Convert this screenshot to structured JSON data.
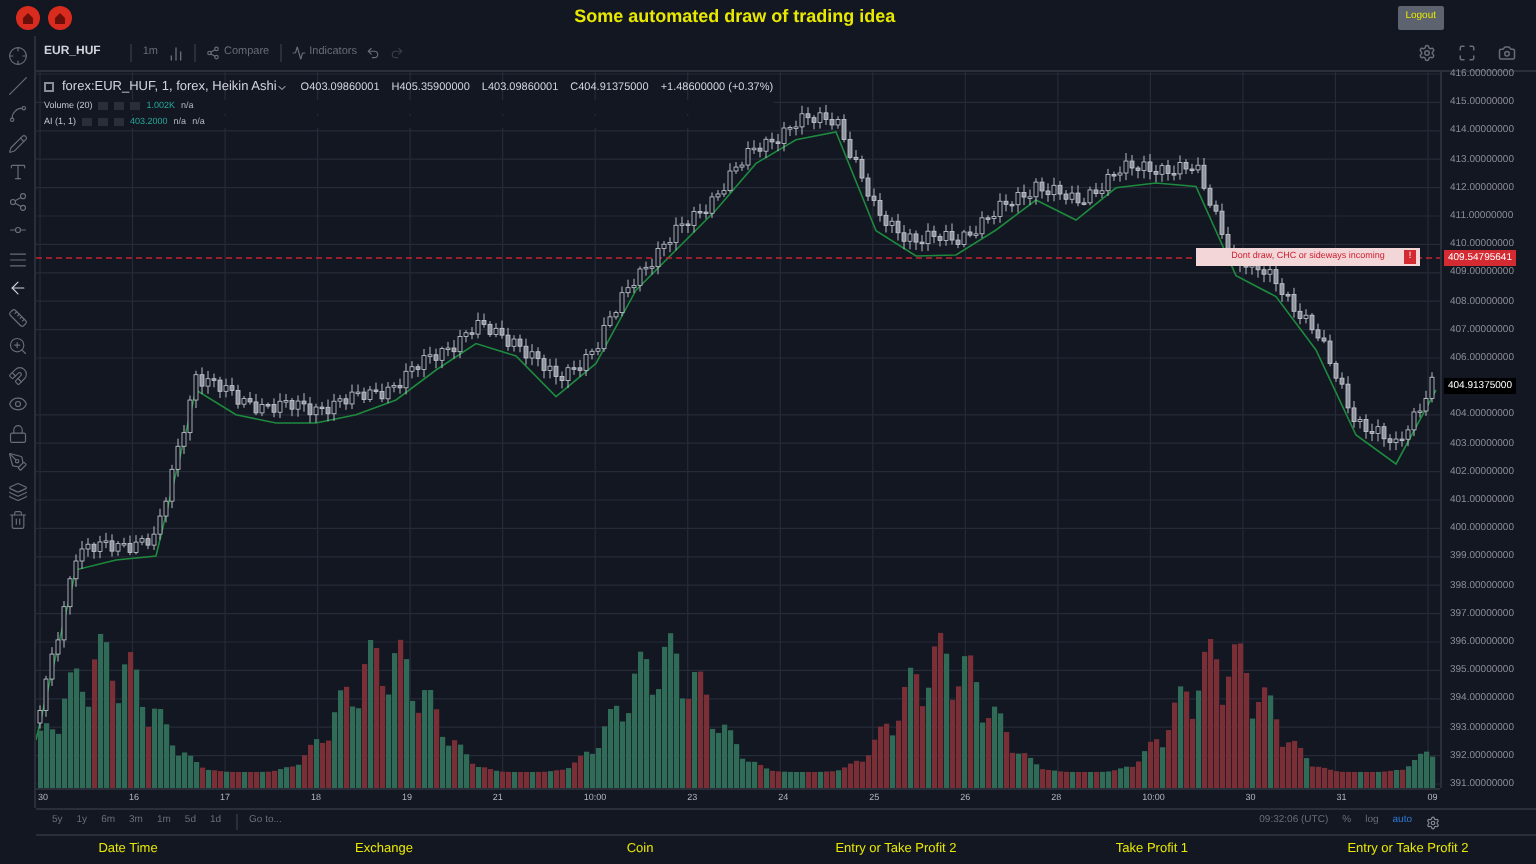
{
  "header": {
    "title": "Some automated draw of trading idea",
    "logout_button": "Logout"
  },
  "chart_toolbar": {
    "symbol": "EUR_HUF",
    "interval": "1m",
    "compare": "Compare",
    "indicators": "Indicators"
  },
  "legend": {
    "checked": false,
    "title": "forex:EUR_HUF, 1, forex, Heikin Ashi",
    "ohlc": [
      "O403.09860001",
      "H405.35900000",
      "L403.09860001",
      "C404.91375000",
      "+1.48600000 (+0.37%)"
    ],
    "studies": [
      {
        "name": "Volume (20)",
        "values": [
          {
            "text": "1.002K",
            "kind": "value"
          },
          {
            "text": "n/a",
            "kind": "na"
          }
        ]
      },
      {
        "name": "AI (1, 1)",
        "values": [
          {
            "text": "403.2000",
            "kind": "value"
          },
          {
            "text": "n/a",
            "kind": "na"
          },
          {
            "text": "n/a",
            "kind": "na"
          }
        ]
      }
    ]
  },
  "annotation": {
    "text": "Dont draw, CHC or sideways incoming",
    "marker": "!"
  },
  "chart_data": {
    "type": "line",
    "grid": true,
    "ylim": [
      390.86,
      416.07
    ],
    "yticks": [
      {
        "value": 416,
        "label": "416.00000000"
      },
      {
        "value": 415,
        "label": "415.00000000"
      },
      {
        "value": 414,
        "label": "414.00000000"
      },
      {
        "value": 413,
        "label": "413.00000000"
      },
      {
        "value": 412,
        "label": "412.00000000"
      },
      {
        "value": 411,
        "label": "411.00000000"
      },
      {
        "value": 410,
        "label": "410.00000000"
      },
      {
        "value": 409,
        "label": "409.00000000"
      },
      {
        "value": 408,
        "label": "408.00000000"
      },
      {
        "value": 407,
        "label": "407.00000000"
      },
      {
        "value": 406,
        "label": "406.00000000"
      },
      {
        "value": 404,
        "label": "404.00000000"
      },
      {
        "value": 403,
        "label": "403.00000000"
      },
      {
        "value": 402,
        "label": "402.00000000"
      },
      {
        "value": 401,
        "label": "401.00000000"
      },
      {
        "value": 400,
        "label": "400.00000000"
      },
      {
        "value": 399,
        "label": "399.00000000"
      },
      {
        "value": 398,
        "label": "398.00000000"
      },
      {
        "value": 397,
        "label": "397.00000000"
      },
      {
        "value": 396,
        "label": "396.00000000"
      },
      {
        "value": 395,
        "label": "395.00000000"
      },
      {
        "value": 394,
        "label": "394.00000000"
      },
      {
        "value": 393,
        "label": "393.00000000"
      },
      {
        "value": 392,
        "label": "392.00000000"
      },
      {
        "value": 391,
        "label": "391.00000000"
      }
    ],
    "series": [
      {
        "color": "#1e8a3e",
        "values": [
          392.55,
          398.54,
          398.89,
          399.03,
          404.87,
          404.0,
          403.71,
          403.71,
          404.0,
          404.52,
          405.58,
          406.51,
          406.07,
          404.64,
          405.81,
          408.39,
          409.8,
          411.21,
          412.85,
          413.68,
          413.96,
          410.48,
          409.59,
          409.63,
          410.51,
          411.56,
          410.86,
          411.99,
          412.16,
          412.04,
          408.9,
          408.16,
          406.28,
          403.29,
          402.27,
          404.87
        ]
      }
    ]
  },
  "price_axis": {
    "alert_price": "409.54795641",
    "last_price": "404.91375000"
  },
  "time_axis": {
    "labels": [
      "30",
      "16",
      "17",
      "18",
      "19",
      "21",
      "10:00",
      "23",
      "24",
      "25",
      "26",
      "28",
      "10:00",
      "30",
      "31",
      "09"
    ]
  },
  "range_bar": {
    "ranges": [
      "5y",
      "1y",
      "6m",
      "3m",
      "1m",
      "5d",
      "1d"
    ],
    "goto": "Go to...",
    "clock": "09:32:06 (UTC)",
    "scale_modes": [
      {
        "label": "%",
        "selected": false
      },
      {
        "label": "log",
        "selected": false
      },
      {
        "label": "auto",
        "selected": true
      }
    ]
  },
  "footer": {
    "columns": [
      "Date Time",
      "Exchange",
      "Coin",
      "Entry or Take Profit 2",
      "Take Profit 1",
      "Entry or Take Profit 2"
    ]
  }
}
